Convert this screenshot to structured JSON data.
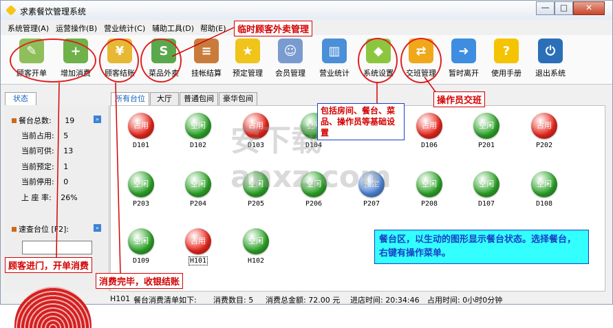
{
  "window": {
    "title": "求素餐饮管理系统",
    "controls": {
      "min": "—",
      "max": "□",
      "close": "✕"
    }
  },
  "menu": [
    {
      "label": "系统管理(A)"
    },
    {
      "label": "运营操作(B)"
    },
    {
      "label": "营业统计(C)"
    },
    {
      "label": "辅助工具(D)"
    },
    {
      "label": "帮助(E)"
    }
  ],
  "toolbar": [
    {
      "label": "顾客开单",
      "icon": "open-order-icon",
      "color": "#8fbf5a",
      "glyph": "✎"
    },
    {
      "label": "增加消费",
      "icon": "add-consume-icon",
      "color": "#6fb24a",
      "glyph": "+"
    },
    {
      "label": "顾客结账",
      "icon": "coins-icon",
      "color": "#e6b833",
      "glyph": "¥"
    },
    {
      "label": "菜品外卖",
      "icon": "sale-icon",
      "color": "#5aa84c",
      "glyph": "S"
    },
    {
      "label": "挂帐结算",
      "icon": "ledger-icon",
      "color": "#c97b3b",
      "glyph": "≡"
    },
    {
      "label": "预定管理",
      "icon": "star-clock-icon",
      "color": "#f0c419",
      "glyph": "★"
    },
    {
      "label": "会员管理",
      "icon": "members-icon",
      "color": "#7a9bd0",
      "glyph": "☺"
    },
    {
      "label": "营业统计",
      "icon": "stats-chart-icon",
      "color": "#4a8fd8",
      "glyph": "▥"
    },
    {
      "label": "系统设置",
      "icon": "settings-cubes-icon",
      "color": "#8cc63f",
      "glyph": "◆"
    },
    {
      "label": "交班管理",
      "icon": "handover-icon",
      "color": "#f0a81a",
      "glyph": "⇄"
    },
    {
      "label": "暂时离开",
      "icon": "running-man-icon",
      "color": "#3d8de0",
      "glyph": "➜"
    },
    {
      "label": "使用手册",
      "icon": "help-question-icon",
      "color": "#f5c400",
      "glyph": "?"
    },
    {
      "label": "退出系统",
      "icon": "power-icon",
      "color": "#2a6fb8",
      "glyph": "⏻"
    }
  ],
  "left_panel": {
    "tab": "状态",
    "stats": [
      {
        "label": "餐台总数:",
        "value": "19"
      },
      {
        "label": "当前占用:",
        "value": "5"
      },
      {
        "label": "当前可供:",
        "value": "13"
      },
      {
        "label": "当前预定:",
        "value": "1"
      },
      {
        "label": "当前停用:",
        "value": "0"
      },
      {
        "label": "上 座 率:",
        "value": "26%"
      }
    ],
    "quick_label": "速查台位 [F2]:",
    "quick_value": "",
    "more_icon": "»"
  },
  "tabs": [
    {
      "label": "所有台位",
      "active": true
    },
    {
      "label": "大厅",
      "active": false
    },
    {
      "label": "普通包间",
      "active": false
    },
    {
      "label": "豪华包间",
      "active": false
    }
  ],
  "status_colors": {
    "占用": "#e8281e",
    "空闲": "#2fa52a",
    "预定": "#4f86d6"
  },
  "tables": [
    {
      "code": "D101",
      "status": "占用"
    },
    {
      "code": "D102",
      "status": "空闲"
    },
    {
      "code": "D103",
      "status": "占用"
    },
    {
      "code": "D104",
      "status": "空闲"
    },
    {
      "code": "",
      "status": ""
    },
    {
      "code": "D106",
      "status": "占用"
    },
    {
      "code": "P201",
      "status": "空闲"
    },
    {
      "code": "P202",
      "status": "占用"
    },
    {
      "code": "P203",
      "status": "空闲"
    },
    {
      "code": "P204",
      "status": "空闲"
    },
    {
      "code": "P205",
      "status": "空闲"
    },
    {
      "code": "P206",
      "status": "空闲"
    },
    {
      "code": "P207",
      "status": "预定"
    },
    {
      "code": "P208",
      "status": "空闲"
    },
    {
      "code": "D107",
      "status": "空闲"
    },
    {
      "code": "D108",
      "status": "空闲"
    },
    {
      "code": "D109",
      "status": "空闲"
    },
    {
      "code": "H101",
      "status": "占用"
    },
    {
      "code": "H102",
      "status": "空闲"
    }
  ],
  "statusbar": {
    "table": "H101",
    "list_label": "餐台消费清单如下:",
    "count": "消费数目: 5",
    "amount": "消费总金额: 72.00 元",
    "entry": "进店时间: 20:34:46",
    "duration": "占用时间: 0小时0分钟"
  },
  "annotations": {
    "takeout": "临时顾客外卖管理",
    "handover": "操作员交班",
    "settings": "包括房间、餐台、菜品、操作员等基础设置",
    "open": "顾客进门，开单消费",
    "checkout": "消费完毕，收银结账",
    "area": "餐台区，以生动的图形显示餐台状态。选择餐台，右键有操作菜单。"
  },
  "watermark": "安下载 anxz.com"
}
